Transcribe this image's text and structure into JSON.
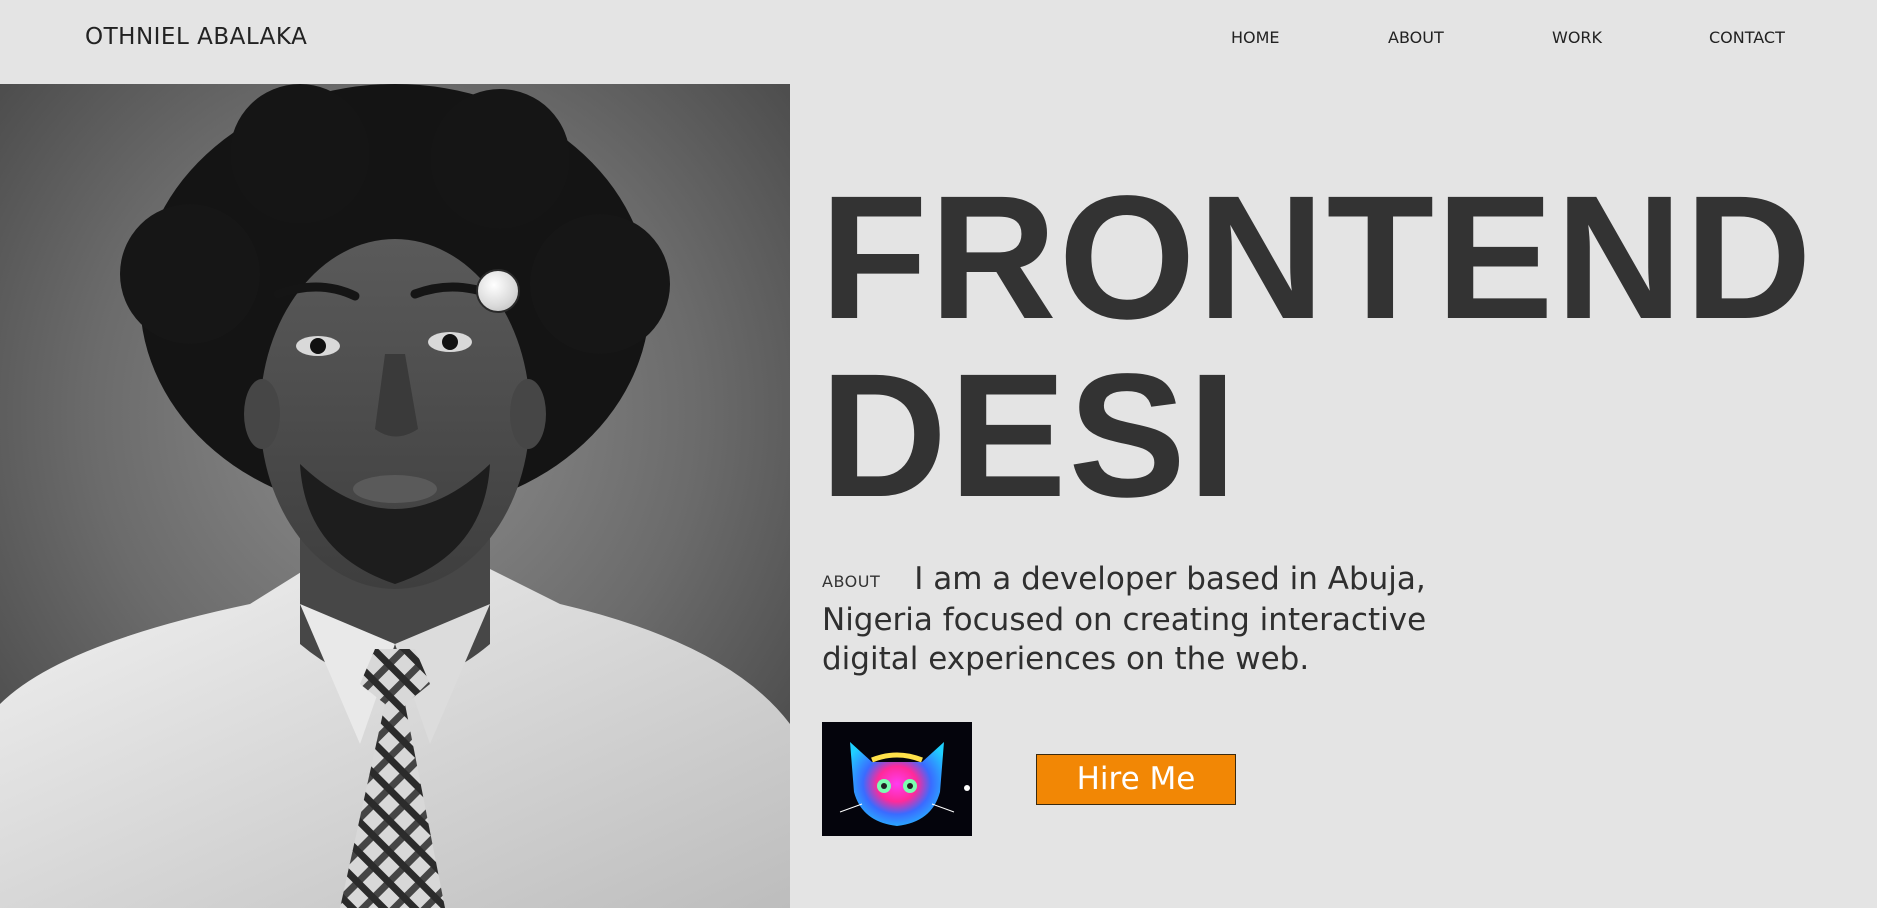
{
  "header": {
    "brand": "OTHNIEL ABALAKA",
    "nav": [
      "HOME",
      "ABOUT",
      "WORK",
      "CONTACT"
    ]
  },
  "hero": {
    "headline_line1": "FRONTEND",
    "headline_line2": "DESI",
    "about_label": "ABOUT",
    "about_text": "I am a developer based in Abuja, Nigeria focused on creating interactive digital experiences on the web.",
    "hire_button": "Hire Me"
  },
  "images": {
    "portrait": "portrait-photo",
    "thumbnail": "psychedelic-cat-thumbnail"
  },
  "colors": {
    "background": "#e4e4e4",
    "headline": "#333333",
    "hire_button": "#f28705",
    "hire_button_text": "#ffffff"
  }
}
